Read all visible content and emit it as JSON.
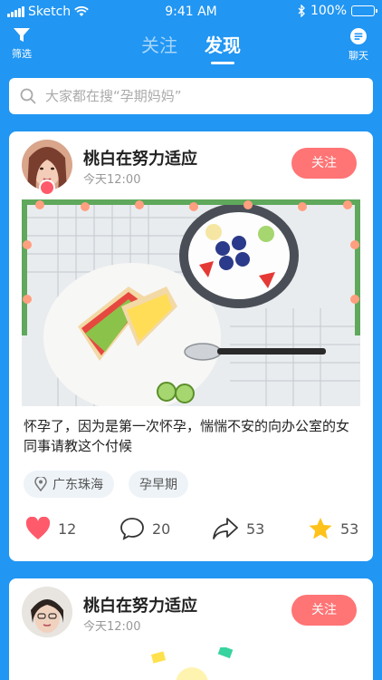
{
  "status_bar": {
    "carrier": "Sketch",
    "time": "9:41 AM",
    "battery": "100%"
  },
  "nav": {
    "filter_label": "筛选",
    "chat_label": "聊天",
    "tabs": [
      {
        "label": "关注",
        "active": false
      },
      {
        "label": "发现",
        "active": true
      }
    ]
  },
  "search": {
    "placeholder": "大家都在搜“孕期妈妈”",
    "value": ""
  },
  "posts": [
    {
      "username": "桃白在努力适应",
      "time": "今天12:00",
      "follow_label": "关注",
      "text": "怀孕了，因为是第一次怀孕，惴惴不安的向办公室的女同事请教这个付候",
      "tags": [
        "广东珠海",
        "孕早期"
      ],
      "likes": "12",
      "comments": "20",
      "shares": "53",
      "favorites": "53"
    },
    {
      "username": "桃白在努力适应",
      "time": "今天12:00",
      "follow_label": "关注"
    }
  ],
  "colors": {
    "brand_blue": "#2196f3",
    "follow_pink": "#ff7475",
    "heart_red": "#ff5a6b",
    "star_yellow": "#ffc21a"
  },
  "icons": [
    "signal-icon",
    "wifi-icon",
    "bluetooth-icon",
    "battery-icon",
    "filter-icon",
    "chat-icon",
    "search-icon",
    "location-icon",
    "heart-icon",
    "comment-icon",
    "share-icon",
    "star-icon"
  ]
}
